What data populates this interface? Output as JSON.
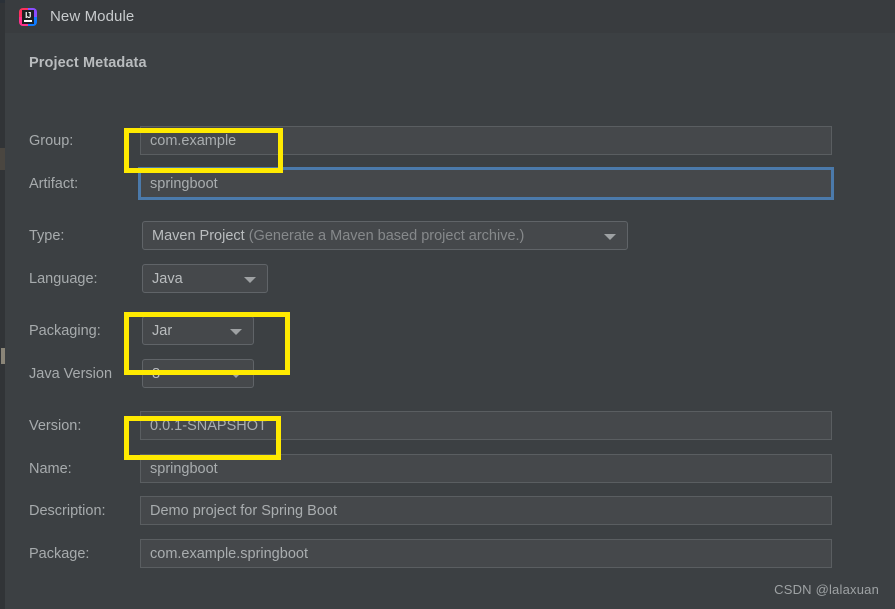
{
  "window": {
    "title": "New Module",
    "app_icon": "intellij-idea-icon"
  },
  "section": {
    "title": "Project Metadata"
  },
  "fields": [
    {
      "label": "Group:",
      "value": "com.example",
      "kind": "text",
      "focused": false,
      "highlighted": false
    },
    {
      "label": "Artifact:",
      "value": "springboot",
      "kind": "text",
      "focused": true,
      "highlighted": true
    },
    {
      "label": "Type:",
      "value": "Maven Project",
      "hint": "(Generate a Maven based project archive.)",
      "kind": "combo",
      "focused": false,
      "highlighted": false
    },
    {
      "label": "Language:",
      "value": "Java",
      "kind": "combo",
      "focused": false,
      "highlighted": false
    },
    {
      "label": "Packaging:",
      "value": "Jar",
      "kind": "combo",
      "focused": false,
      "highlighted": false
    },
    {
      "label": "Java Version",
      "value": "8",
      "kind": "combo",
      "focused": false,
      "highlighted": true
    },
    {
      "label": "Version:",
      "value": "0.0.1-SNAPSHOT",
      "kind": "text",
      "focused": false,
      "highlighted": false
    },
    {
      "label": "Name:",
      "value": "springboot",
      "kind": "text",
      "focused": false,
      "highlighted": true
    },
    {
      "label": "Description:",
      "value": "Demo project for Spring Boot",
      "kind": "text",
      "focused": false,
      "highlighted": false
    },
    {
      "label": "Package:",
      "value": "com.example.springboot",
      "kind": "text",
      "focused": false,
      "highlighted": false
    }
  ],
  "watermark": {
    "text": "CSDN @lalaxuan"
  },
  "colors": {
    "background": "#3c4043",
    "titlebar": "#393c3f",
    "field_background": "#45484b",
    "field_border": "#5a5e61",
    "focus_blue": "#4b7aab",
    "highlight_yellow": "#ffea00",
    "label_text": "#a7abad",
    "value_text": "#a9adaf",
    "hint_text": "#86898b"
  }
}
